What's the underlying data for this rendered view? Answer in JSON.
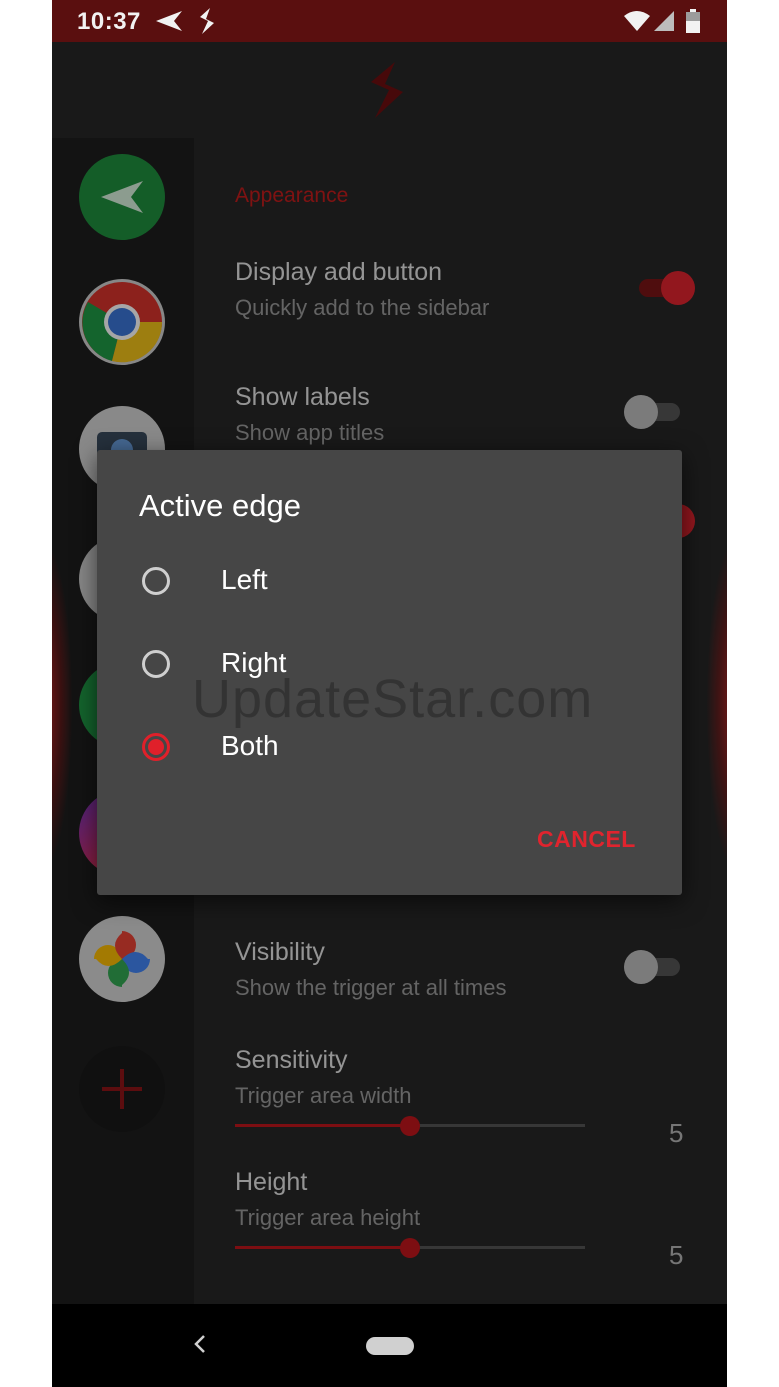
{
  "status_bar": {
    "time": "10:37",
    "left_icons": [
      "send-icon",
      "app-s-logo-icon"
    ],
    "right_icons": [
      "wifi-icon",
      "cell-signal-icon",
      "battery-icon"
    ]
  },
  "colors": {
    "accent": "#e0242e",
    "status_bar_bg": "#5a0f0f",
    "background": "#272727",
    "dialog_bg": "#464646"
  },
  "sidebar_dock": {
    "apps": [
      "send-app-icon",
      "chrome-icon",
      "camera-icon",
      "app-icon",
      "app-icon",
      "app-icon",
      "google-photos-icon"
    ],
    "add_button_icon": "plus-icon"
  },
  "settings": {
    "section_header": "Appearance",
    "items": [
      {
        "title": "Display add button",
        "subtitle": "Quickly add to the sidebar",
        "on": true
      },
      {
        "title": "Show labels",
        "subtitle": "Show app titles",
        "on": false
      }
    ],
    "visibility": {
      "title": "Visibility",
      "subtitle": "Show the trigger at all times",
      "on": false
    },
    "sensitivity": {
      "title": "Sensitivity",
      "subtitle": "Trigger area width",
      "value": "5",
      "fraction": 0.5
    },
    "height": {
      "title": "Height",
      "subtitle": "Trigger area height",
      "value": "5",
      "fraction": 0.5
    }
  },
  "dialog": {
    "title": "Active edge",
    "options": [
      {
        "label": "Left",
        "selected": false
      },
      {
        "label": "Right",
        "selected": false
      },
      {
        "label": "Both",
        "selected": true
      }
    ],
    "cancel_label": "CANCEL"
  },
  "watermark": "UpdateStar.com",
  "nav_bar": {
    "icons": [
      "back-icon",
      "home-pill-icon"
    ]
  }
}
